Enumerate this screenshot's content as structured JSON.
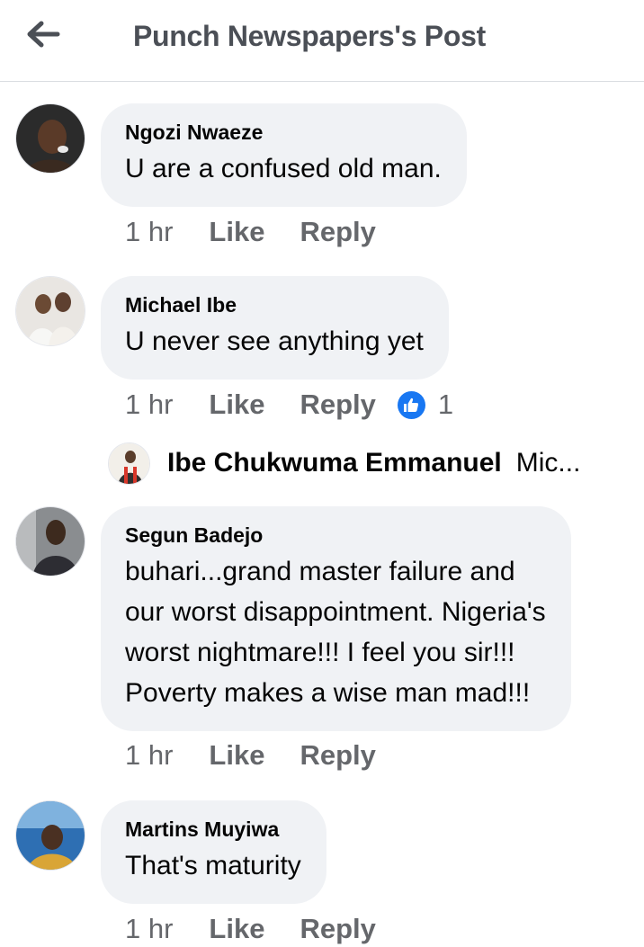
{
  "header": {
    "title": "Punch Newspapers's Post",
    "back_icon": "arrow-left-icon"
  },
  "comments": [
    {
      "author": "Ngozi Nwaeze",
      "text_lines": [
        "U are a confused old man."
      ],
      "time": "1 hr",
      "like_label": "Like",
      "reply_label": "Reply"
    },
    {
      "author": "Michael Ibe",
      "text_lines": [
        "U never see anything yet"
      ],
      "time": "1 hr",
      "like_label": "Like",
      "reply_label": "Reply",
      "reaction_icon": "thumbs-up-icon",
      "reaction_count": "1",
      "reply_preview": {
        "author": "Ibe Chukwuma Emmanuel",
        "text": "Mic..."
      }
    },
    {
      "author": "Segun Badejo",
      "text_lines": [
        "buhari...grand master failure and",
        "our worst disappointment. Nigeria's",
        "worst nightmare!!! I feel you sir!!!",
        "Poverty makes a wise man mad!!!"
      ],
      "time": "1 hr",
      "like_label": "Like",
      "reply_label": "Reply"
    },
    {
      "author": "Martins Muyiwa",
      "text_lines": [
        "That's maturity"
      ],
      "time": "1 hr",
      "like_label": "Like",
      "reply_label": "Reply"
    }
  ],
  "colors": {
    "bubble": "#f0f2f5",
    "meta_text": "#65676b",
    "header_text": "#4b4f56",
    "like_blue": "#1877f2"
  }
}
